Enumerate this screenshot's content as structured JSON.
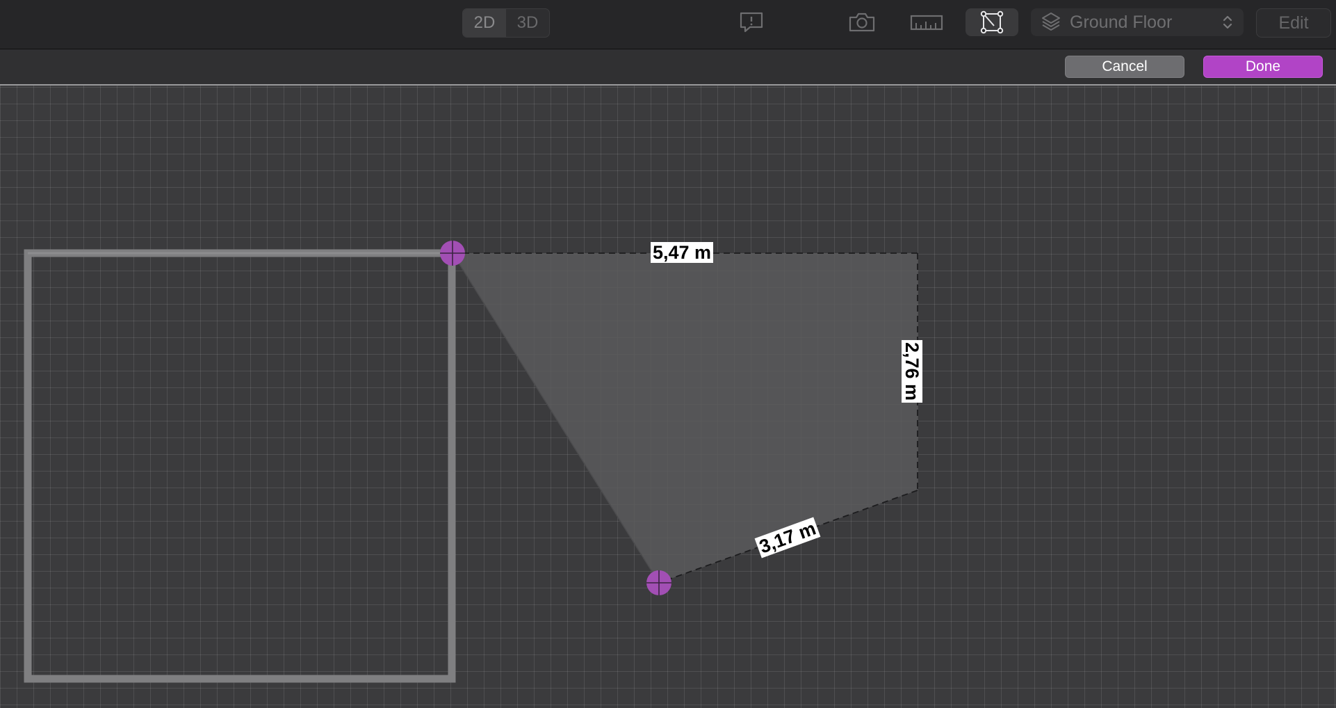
{
  "toolbar": {
    "view_modes": [
      "2D",
      "3D"
    ],
    "active_view_mode": "2D",
    "icons": [
      "report-issue-icon",
      "camera-icon",
      "ruler-icon",
      "room-shape-icon",
      "layers-icon",
      "chevron-updown-icon"
    ],
    "floor_select": {
      "selected": "Ground Floor"
    },
    "edit_label": "Edit"
  },
  "edit_bar": {
    "cancel_label": "Cancel",
    "done_label": "Done"
  },
  "colors": {
    "accent": "#b144c6",
    "handle": "#a24fb4",
    "wall": "#7f7f81"
  },
  "canvas": {
    "dimensions": {
      "top_edge": "5,47 m",
      "right_edge": "2,76 m",
      "diagonal_edge": "3,17 m"
    }
  }
}
